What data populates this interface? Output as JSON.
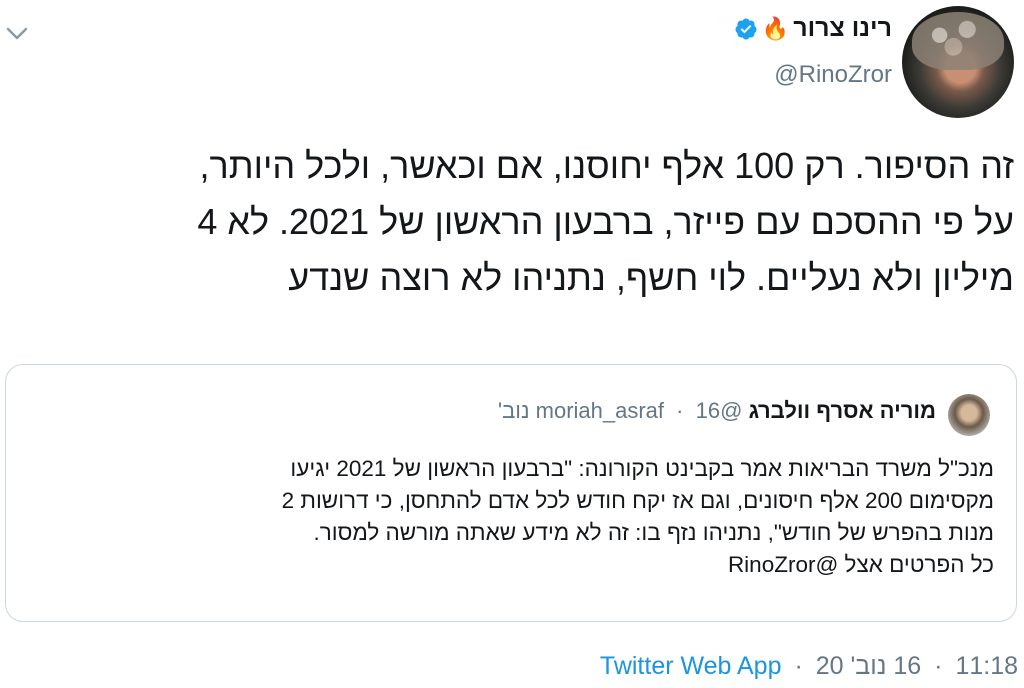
{
  "tweet": {
    "author_name": "רינו צרור",
    "fire_emoji": "🔥",
    "handle": "@RinoZror",
    "text_lines": [
      "זה הסיפור. רק 100 אלף יחוסנו, אם וכאשר, ולכל היותר,",
      "על פי ההסכם עם פייזר, ברבעון הראשון של 2021. לא 4",
      "מיליון ולא נעליים. לוי חשף, נתניהו לא רוצה שנדע"
    ],
    "time": "11:18",
    "date": "16 נוב' 20",
    "source": "Twitter Web App",
    "separator": "·"
  },
  "quoted": {
    "author_name": "מוריה אסרף וולברג",
    "handle": "@moriah_asraf",
    "separator": "·",
    "date": "16 נוב'",
    "body_lines": [
      "מנכ\"ל משרד הבריאות אמר בקבינט הקורונה: \"ברבעון הראשון של 2021 יגיעו",
      "מקסימום 200 אלף חיסונים, וגם אז יקח חודש לכל אדם להתחסן, כי דרושות 2",
      "מנות בהפרש של חודש\", נתניהו נזף בו: זה לא מידע שאתה מורשה למסור.",
      "כל הפרטים אצל @RinoZror"
    ]
  },
  "colors": {
    "verified": "#1da1f2",
    "link": "#1b95e0",
    "muted": "#657786"
  },
  "icons": {
    "chevron": "chevron-down-icon",
    "verified": "verified-badge-icon"
  }
}
